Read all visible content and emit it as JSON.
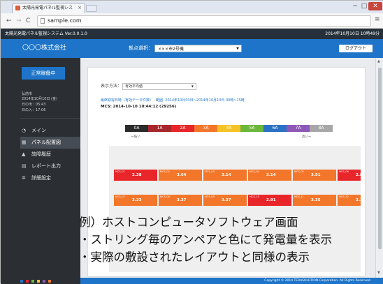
{
  "browser": {
    "tab_title": "太陽光発電パネル監視シス",
    "tab_close": "×",
    "url": "sample.com",
    "back": "←",
    "forward": "→",
    "reload": "C",
    "home": "⌂",
    "menu": "≡",
    "win_min": "−",
    "win_max": "□",
    "win_close": "✕"
  },
  "app": {
    "title": "太陽光発電パネル監視システム Ver.0.0.1.0",
    "datetime": "2014年10月10日 10時49分",
    "company": "〇〇〇株式会社",
    "site_label": "拠点選択：",
    "site_value": "×××市2号機",
    "logout": "ログアウト"
  },
  "sidebar": {
    "status": "正常稼働中",
    "city": "弘前市",
    "date": "2014年10月10日 (金)",
    "sunrise": "日の出：05:43",
    "sunset": "日の入：17:06",
    "items": [
      {
        "label": "メイン",
        "icon": "dashboard-icon",
        "glyph": "◔"
      },
      {
        "label": "パネル配置図",
        "icon": "grid-icon",
        "glyph": "▦"
      },
      {
        "label": "故障履歴",
        "icon": "warning-icon",
        "glyph": "▲"
      },
      {
        "label": "レポート出力",
        "icon": "document-icon",
        "glyph": "▤"
      },
      {
        "label": "詳細設定",
        "icon": "gear-icon",
        "glyph": "✲"
      }
    ]
  },
  "main": {
    "display_method_label": "表示方法：",
    "display_method_value": "有効平均値",
    "acquisition_label": "最終取得日時（有効データ件数）",
    "acquisition_range": "範囲: 2014年10月03日~2014年10月10日 00時~15時",
    "mcs_line": "MCS: 2014-10-10 10:44:12 (29256)",
    "legend": [
      {
        "label": "0A",
        "color": "#2b2b2b"
      },
      {
        "label": "1A",
        "color": "#a8272c"
      },
      {
        "label": "2A",
        "color": "#e8262a"
      },
      {
        "label": "3A",
        "color": "#f3772a"
      },
      {
        "label": "4A",
        "color": "#f6c326"
      },
      {
        "label": "5A",
        "color": "#6cb83a"
      },
      {
        "label": "6A",
        "color": "#2a72c6"
      },
      {
        "label": "7A",
        "color": "#8e58b8"
      },
      {
        "label": "8A",
        "color": "#a7a7a7"
      }
    ],
    "legend_low": "←低い",
    "legend_high": "高い→",
    "rows": [
      [
        {
          "id": "MCS_01",
          "value": "2.38",
          "color": "#e8262a"
        },
        {
          "id": "MCS_02",
          "value": "3.64",
          "color": "#f3772a"
        },
        {
          "id": "MCS_03",
          "value": "3.14",
          "color": "#f3772a"
        },
        {
          "id": "MCS_04",
          "value": "3.14",
          "color": "#f3772a"
        },
        {
          "id": "MCS_05",
          "value": "3.51",
          "color": "#f3772a"
        },
        {
          "id": "MCS_06",
          "value": "2.8",
          "color": "#e8262a"
        }
      ],
      [
        {
          "id": "MCS_07",
          "value": "3.33",
          "color": "#f3772a"
        },
        {
          "id": "MCS_08",
          "value": "3.37",
          "color": "#f3772a"
        },
        {
          "id": "MCS_09",
          "value": "3.37",
          "color": "#f3772a"
        },
        {
          "id": "MCS_10",
          "value": "2.91",
          "color": "#e8262a"
        },
        {
          "id": "MCS_11",
          "value": "3.35",
          "color": "#f3772a"
        },
        {
          "id": "MCS_12",
          "value": "3.1",
          "color": "#f3772a"
        }
      ]
    ]
  },
  "footer": {
    "copyright": "Copyright © 2014 TERASOLUTION Corporation. All Rights Reserved."
  },
  "caption": {
    "line1": "例）ホストコンピュータソフトウェア画面",
    "line2": "・ストリング毎のアンペアと色にて発電量を表示",
    "line3": "・実際の敷設されたレイアウトと同様の表示"
  },
  "taskbar_colors": [
    "#2a72c6",
    "#e8262a",
    "#6cb83a",
    "#f6c326",
    "#8e58b8",
    "#f3772a"
  ]
}
